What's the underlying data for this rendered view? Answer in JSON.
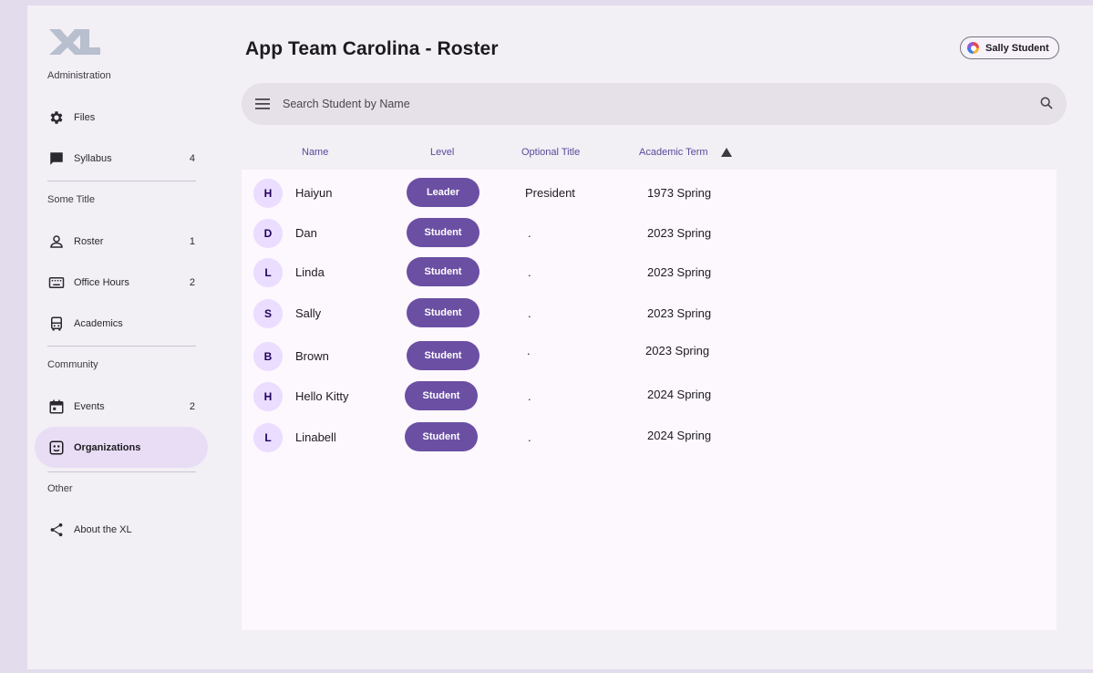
{
  "brand": {
    "logo_text": "XL"
  },
  "sidebar": {
    "sections": [
      {
        "title": "Administration"
      },
      {
        "title": "Some Title"
      },
      {
        "title": "Community"
      },
      {
        "title": "Other"
      }
    ],
    "items": [
      {
        "label": "Files",
        "icon": "gear-icon",
        "badge": ""
      },
      {
        "label": "Syllabus",
        "icon": "chat-icon",
        "badge": "4"
      },
      {
        "label": "Roster",
        "icon": "person-icon",
        "badge": "1"
      },
      {
        "label": "Office Hours",
        "icon": "keyboard-icon",
        "badge": "2"
      },
      {
        "label": "Academics",
        "icon": "bus-icon",
        "badge": ""
      },
      {
        "label": "Events",
        "icon": "calendar-icon",
        "badge": "2"
      },
      {
        "label": "Organizations",
        "icon": "org-icon",
        "badge": "",
        "active": true
      },
      {
        "label": "About the XL",
        "icon": "share-icon",
        "badge": ""
      }
    ]
  },
  "header": {
    "title": "App Team Carolina - Roster"
  },
  "user": {
    "name": "Sally Student"
  },
  "search": {
    "placeholder": "Search Student by Name"
  },
  "table": {
    "columns": [
      "Name",
      "Level",
      "Optional Title",
      "Academic Term"
    ],
    "sort": {
      "column": "Academic Term",
      "direction": "ascending"
    },
    "rows": [
      {
        "initial": "H",
        "name": "Haiyun",
        "level": "Leader",
        "title": "President",
        "term": "1973 Spring"
      },
      {
        "initial": "D",
        "name": "Dan",
        "level": "Student",
        "title": ".",
        "term": "2023 Spring"
      },
      {
        "initial": "L",
        "name": "Linda",
        "level": "Student",
        "title": ".",
        "term": "2023 Spring"
      },
      {
        "initial": "S",
        "name": "Sally",
        "level": "Student",
        "title": ".",
        "term": "2023 Spring"
      },
      {
        "initial": "B",
        "name": "Brown",
        "level": "Student",
        "title": ".",
        "term": "2023 Spring"
      },
      {
        "initial": "H",
        "name": "Hello Kitty",
        "level": "Student",
        "title": ".",
        "term": "2024 Spring"
      },
      {
        "initial": "L",
        "name": "Linabell",
        "level": "Student",
        "title": ".",
        "term": "2024 Spring"
      }
    ]
  },
  "colors": {
    "accent": "#6b4fa3",
    "active_nav": "#e9ddf6",
    "avatar_bg": "#eaddff"
  }
}
